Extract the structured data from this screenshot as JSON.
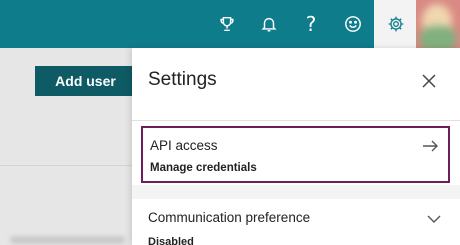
{
  "topbar": {
    "icons": [
      "trophy-icon",
      "bell-icon",
      "help-icon",
      "smiley-icon",
      "gear-icon"
    ],
    "help_glyph": "?",
    "background": "#0f7c8c"
  },
  "background_page": {
    "add_user_label": "Add user"
  },
  "settings": {
    "title": "Settings",
    "api_access": {
      "title": "API access",
      "subtitle": "Manage credentials",
      "highlight_color": "#6b1d5c"
    },
    "communication": {
      "title": "Communication preference",
      "status": "Disabled"
    }
  }
}
